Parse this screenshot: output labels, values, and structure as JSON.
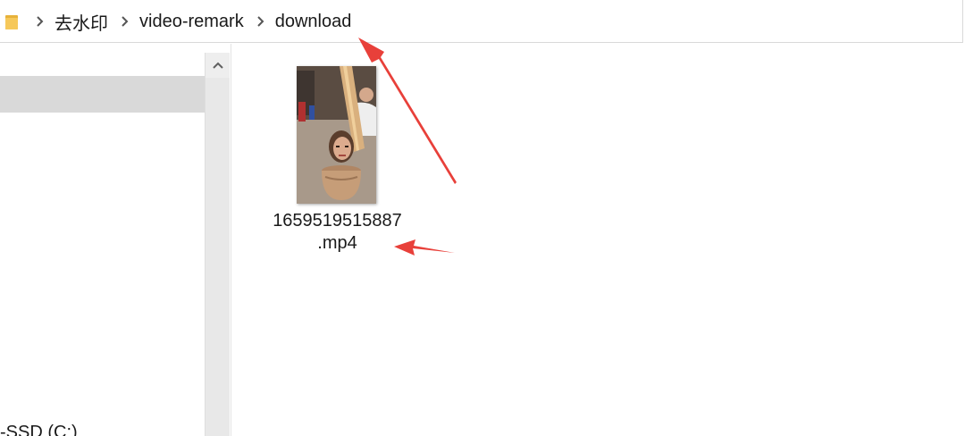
{
  "address_bar": {
    "crumbs": [
      "去水印",
      "video-remark",
      "download"
    ]
  },
  "nav_pane": {
    "drive_label": "-SSD (C:)"
  },
  "content": {
    "files": [
      {
        "name_line1": "1659519515887",
        "name_line2": ".mp4",
        "type_icon": "video-thumbnail"
      }
    ]
  },
  "colors": {
    "annotation_arrow": "#e8403a",
    "selection_bg": "#d9d9d9",
    "folder_icon": "#f4c04c"
  },
  "icons": [
    "folder-icon",
    "chevron-right-icon",
    "scroll-up-icon",
    "video-thumbnail"
  ]
}
